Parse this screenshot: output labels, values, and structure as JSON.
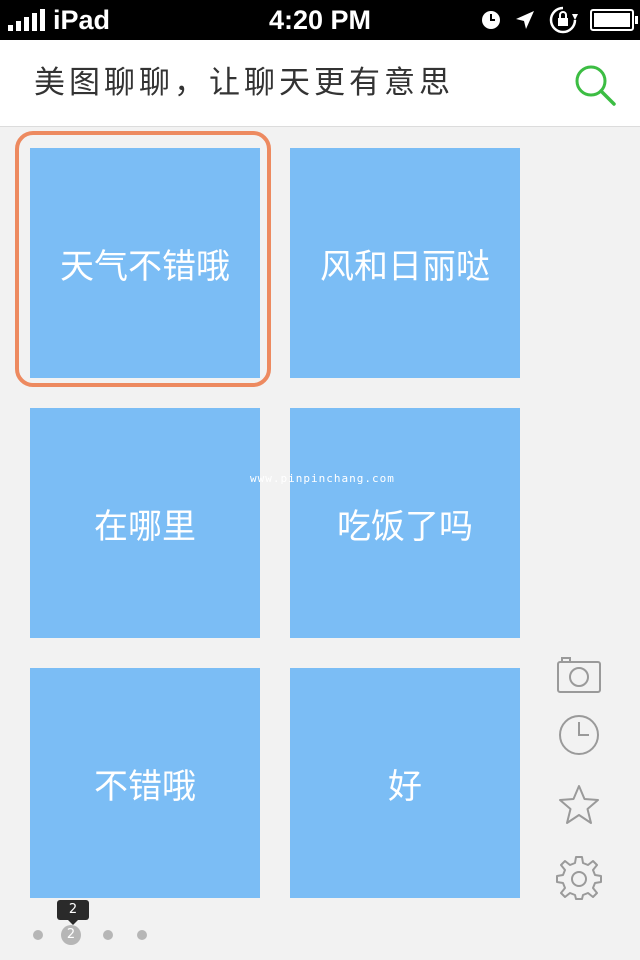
{
  "status_bar": {
    "carrier": "iPad",
    "time": "4:20 PM"
  },
  "header": {
    "slogan": "美图聊聊，让聊天更有意思",
    "search_icon": "search-icon",
    "accent_color": "#3cbd43"
  },
  "phrases": [
    {
      "label": "天气不错哦",
      "selected": true
    },
    {
      "label": "风和日丽哒",
      "selected": false
    },
    {
      "label": "在哪里",
      "selected": false
    },
    {
      "label": "吃饭了吗",
      "selected": false
    },
    {
      "label": "不错哦",
      "selected": false
    },
    {
      "label": "好",
      "selected": false
    }
  ],
  "tile_color": "#7bbdf5",
  "selection_color": "#ed8a60",
  "side_toolbar": [
    "camera-icon",
    "clock-icon",
    "star-icon",
    "gear-icon"
  ],
  "watermark": "www.pinpinchang.com",
  "pager": {
    "current": "2",
    "tooltip": "2"
  }
}
